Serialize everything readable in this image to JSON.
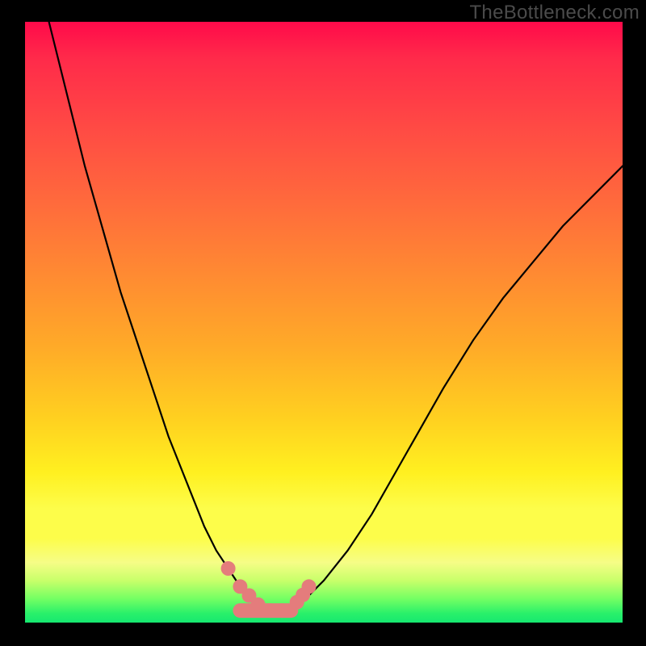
{
  "watermark": {
    "text": "TheBottleneck.com"
  },
  "chart_data": {
    "type": "line",
    "title": "",
    "xlabel": "",
    "ylabel": "",
    "xlim": [
      0,
      100
    ],
    "ylim": [
      0,
      100
    ],
    "series": [
      {
        "name": "bottleneck-curve",
        "x": [
          4,
          6,
          8,
          10,
          12,
          14,
          16,
          18,
          20,
          22,
          24,
          26,
          28,
          30,
          32,
          34,
          36,
          38,
          41,
          44,
          47,
          50,
          54,
          58,
          62,
          66,
          70,
          75,
          80,
          85,
          90,
          95,
          100
        ],
        "values": [
          100,
          92,
          84,
          76,
          69,
          62,
          55,
          49,
          43,
          37,
          31,
          26,
          21,
          16,
          12,
          9,
          6,
          4,
          2,
          2,
          4,
          7,
          12,
          18,
          25,
          32,
          39,
          47,
          54,
          60,
          66,
          71,
          76
        ]
      }
    ],
    "markers": {
      "name": "highlight-dots",
      "color": "#e47c7c",
      "points_x": [
        34.0,
        36.0,
        37.5,
        39.0,
        41.0,
        43.0,
        45.5,
        46.5,
        47.5
      ],
      "points_y": [
        9.0,
        6.0,
        4.5,
        3.0,
        2.0,
        2.0,
        3.4,
        4.6,
        6.0
      ]
    },
    "bottom_bar": {
      "color": "#e47c7c",
      "x0": 36.0,
      "x1": 44.5,
      "y": 2.0
    }
  }
}
